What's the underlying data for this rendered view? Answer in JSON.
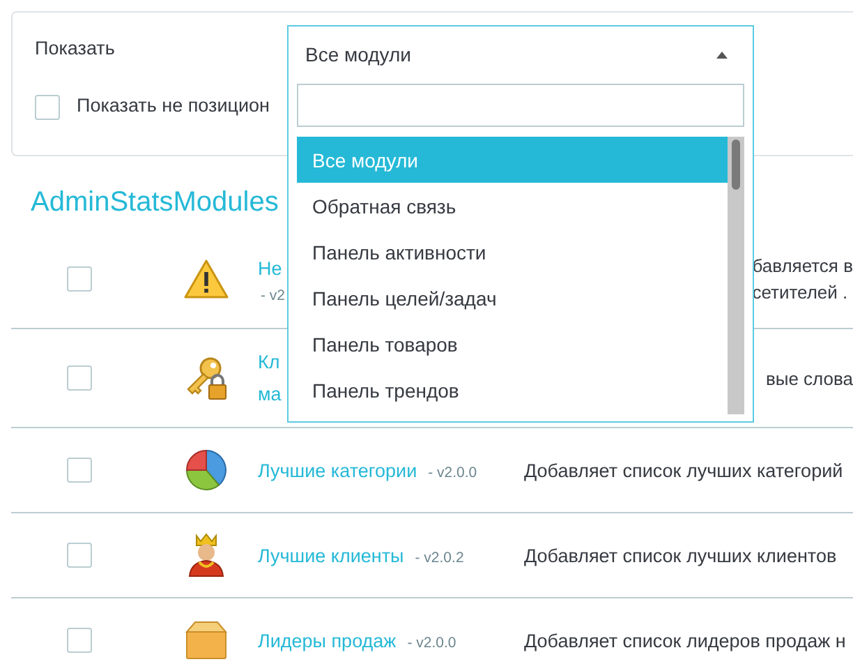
{
  "filter": {
    "label": "Показать",
    "checkbox": {
      "label": "Показать не позицион",
      "checked": false
    }
  },
  "dropdown": {
    "value": "Все модули",
    "expanded": true,
    "options": [
      {
        "label": "Все модули",
        "selected": true
      },
      {
        "label": "Обратная связь",
        "selected": false
      },
      {
        "label": "Панель активности",
        "selected": false
      },
      {
        "label": "Панель целей/задач",
        "selected": false
      },
      {
        "label": "Панель товаров",
        "selected": false
      },
      {
        "label": "Панель трендов",
        "selected": false
      }
    ]
  },
  "title": "AdminStatsModules",
  "rows": [
    {
      "kind": "covered",
      "checked": false,
      "name": [
        "Не"
      ],
      "version": "- v2",
      "description": [
        "бавляется в",
        "сетителей ."
      ]
    },
    {
      "kind": "covered",
      "checked": false,
      "name": [
        "Кл",
        "ма"
      ],
      "version": "",
      "description": [
        "вые слова"
      ]
    },
    {
      "kind": "full",
      "checked": false,
      "name": [
        "Лучшие категории"
      ],
      "version": "- v2.0.0",
      "description": [
        "Добавляет список лучших категорий"
      ]
    },
    {
      "kind": "full",
      "checked": false,
      "name": [
        "Лучшие клиенты"
      ],
      "version": "- v2.0.2",
      "description": [
        "Добавляет список лучших клиентов"
      ]
    },
    {
      "kind": "full",
      "checked": false,
      "name": [
        "Лидеры продаж"
      ],
      "version": "- v2.0.0",
      "description": [
        "Добавляет список лидеров продаж н"
      ]
    }
  ]
}
